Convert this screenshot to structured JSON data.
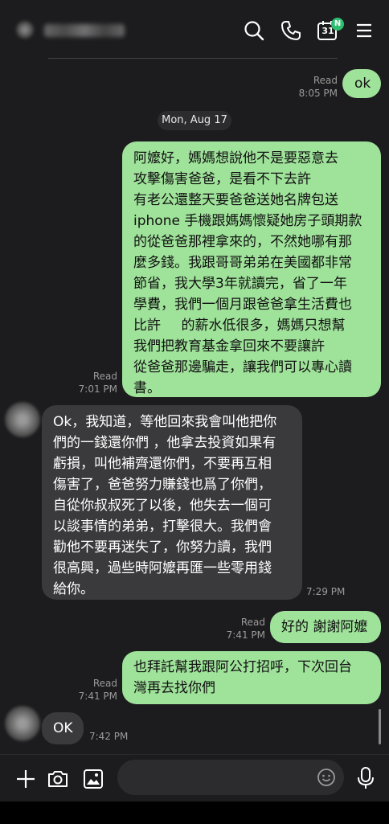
{
  "header": {
    "contact_name": "(blurred)",
    "calendar_day": "31",
    "calendar_badge": "N"
  },
  "date_separator": "Mon, Aug 17",
  "messages": [
    {
      "side": "out",
      "text": "ok",
      "status": "Read",
      "time": "8:05 PM"
    },
    {
      "side": "out",
      "text": "阿嬤好，媽媽想說他不是要惡意去\n攻擊傷害爸爸，是看不下去許   \n有老公還整天要爸爸送她名牌包送\niphone 手機跟媽媽懷疑她房子頭期款\n的從爸爸那裡拿來的，不然她哪有那\n麼多錢。我跟哥哥弟弟在美國都非常\n節省，我大學3年就讀完，省了一年\n學費，我們一個月跟爸爸拿生活費也\n比許   的薪水低很多，媽媽只想幫\n我們把教育基金拿回來不要讓許  \n從爸爸那邊騙走，讓我們可以專心讀\n書。",
      "status": "Read",
      "time": "7:01 PM"
    },
    {
      "side": "in",
      "text": "Ok，我知道，等他回來我會叫他把你\n們的一錢還你們 ，他拿去投資如果有\n虧損，叫他補齊還你們，不要再互相\n傷害了，爸爸努力賺錢也爲了你們，\n自從你叔叔死了以後，他失去一個可\n以談事情的弟弟，打擊很大。我們會\n勸他不要再迷失了，你努力讀，我們\n很高興，過些時阿嬤再匯一些零用錢\n給你。",
      "time": "7:29 PM"
    },
    {
      "side": "out",
      "text": "好的 謝謝阿嬤",
      "status": "Read",
      "time": "7:41 PM"
    },
    {
      "side": "out",
      "text": "也拜託幫我跟阿公打招呼，下次回台\n灣再去找你們",
      "status": "Read",
      "time": "7:41 PM"
    },
    {
      "side": "in",
      "text": "OK",
      "time": "7:42 PM"
    }
  ],
  "colors": {
    "outgoing_bubble": "#9fe29a",
    "incoming_bubble": "#3a3a3c",
    "background": "#1c1c1e",
    "badge": "#2fbf71"
  },
  "icons": [
    "search-icon",
    "phone-icon",
    "calendar-icon",
    "menu-icon",
    "plus-icon",
    "camera-icon",
    "image-icon",
    "emoji-icon",
    "mic-icon"
  ],
  "composer": {
    "placeholder": ""
  }
}
